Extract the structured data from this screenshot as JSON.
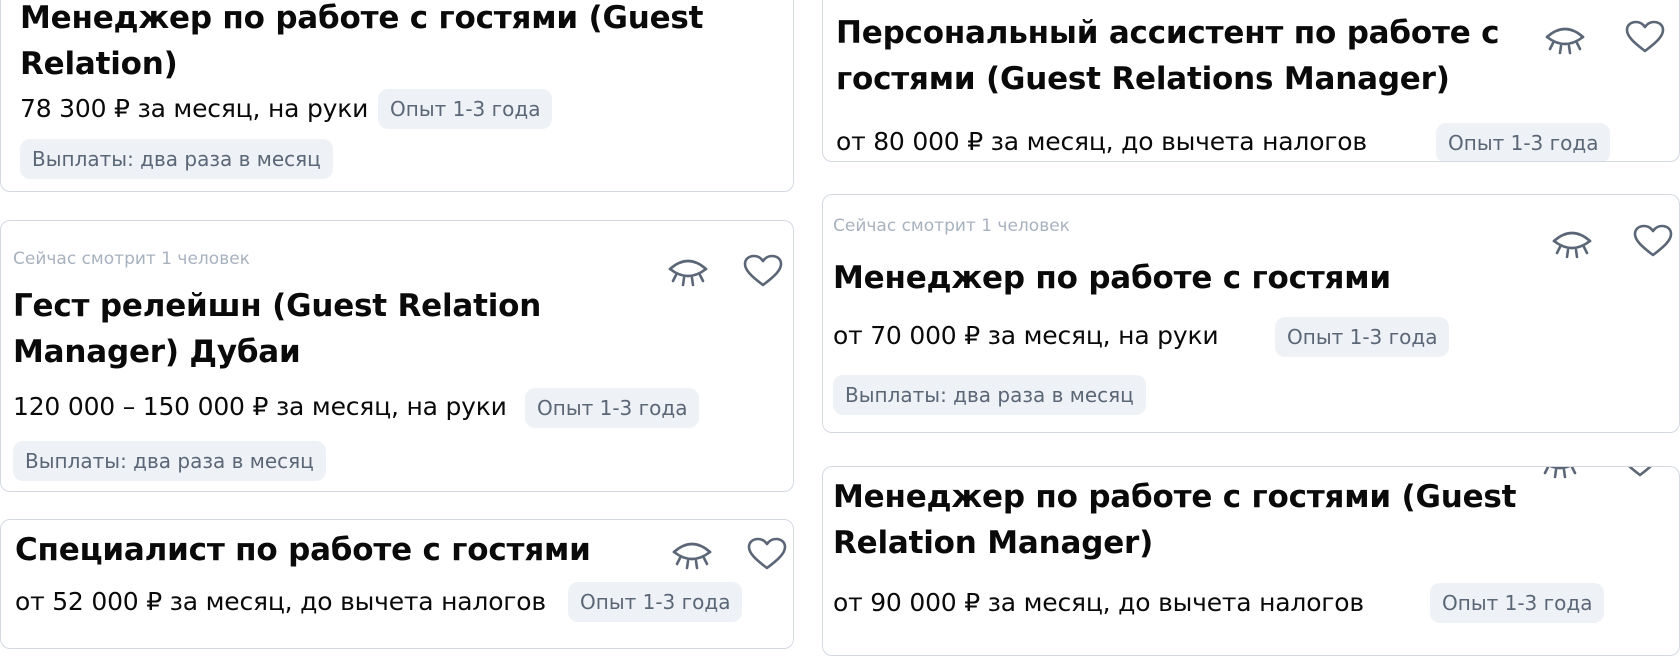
{
  "cards": [
    {
      "title": "Менеджер по работе с гостями (Guest Relation)",
      "salary": "78 300 ₽ за месяц, на руки",
      "experience": "Опыт 1-3 года",
      "payouts": "Выплаты: два раза в месяц"
    },
    {
      "watching": "Сейчас смотрит 1 человек",
      "title": "Гест релейшн (Guest Relation Manager) Дубаи",
      "salary": "120 000 – 150 000 ₽ за месяц, на руки",
      "experience": "Опыт 1-3 года",
      "payouts": "Выплаты: два раза в месяц"
    },
    {
      "title": "Специалист по работе с гостями",
      "salary": "от 52 000 ₽ за месяц, до вычета налогов",
      "experience": "Опыт 1-3 года"
    },
    {
      "title": "Персональный ассистент по работе с гостями (Guest Relations Manager)",
      "salary": "от 80 000 ₽ за месяц, до вычета налогов",
      "experience": "Опыт 1-3 года"
    },
    {
      "watching": "Сейчас смотрит 1 человек",
      "title": "Менеджер по работе с гостями",
      "salary": "от 70 000 ₽ за месяц, на руки",
      "experience": "Опыт 1-3 года",
      "payouts": "Выплаты: два раза в месяц"
    },
    {
      "title": "Менеджер по работе с гостями (Guest Relation Manager)",
      "salary": "от 90 000 ₽ за месяц, до вычета налогов",
      "experience": "Опыт 1-3 года"
    }
  ],
  "icons": {
    "hide": "eye-closed-icon",
    "favorite": "heart-outline-icon",
    "icon_color": "#5b6676"
  }
}
